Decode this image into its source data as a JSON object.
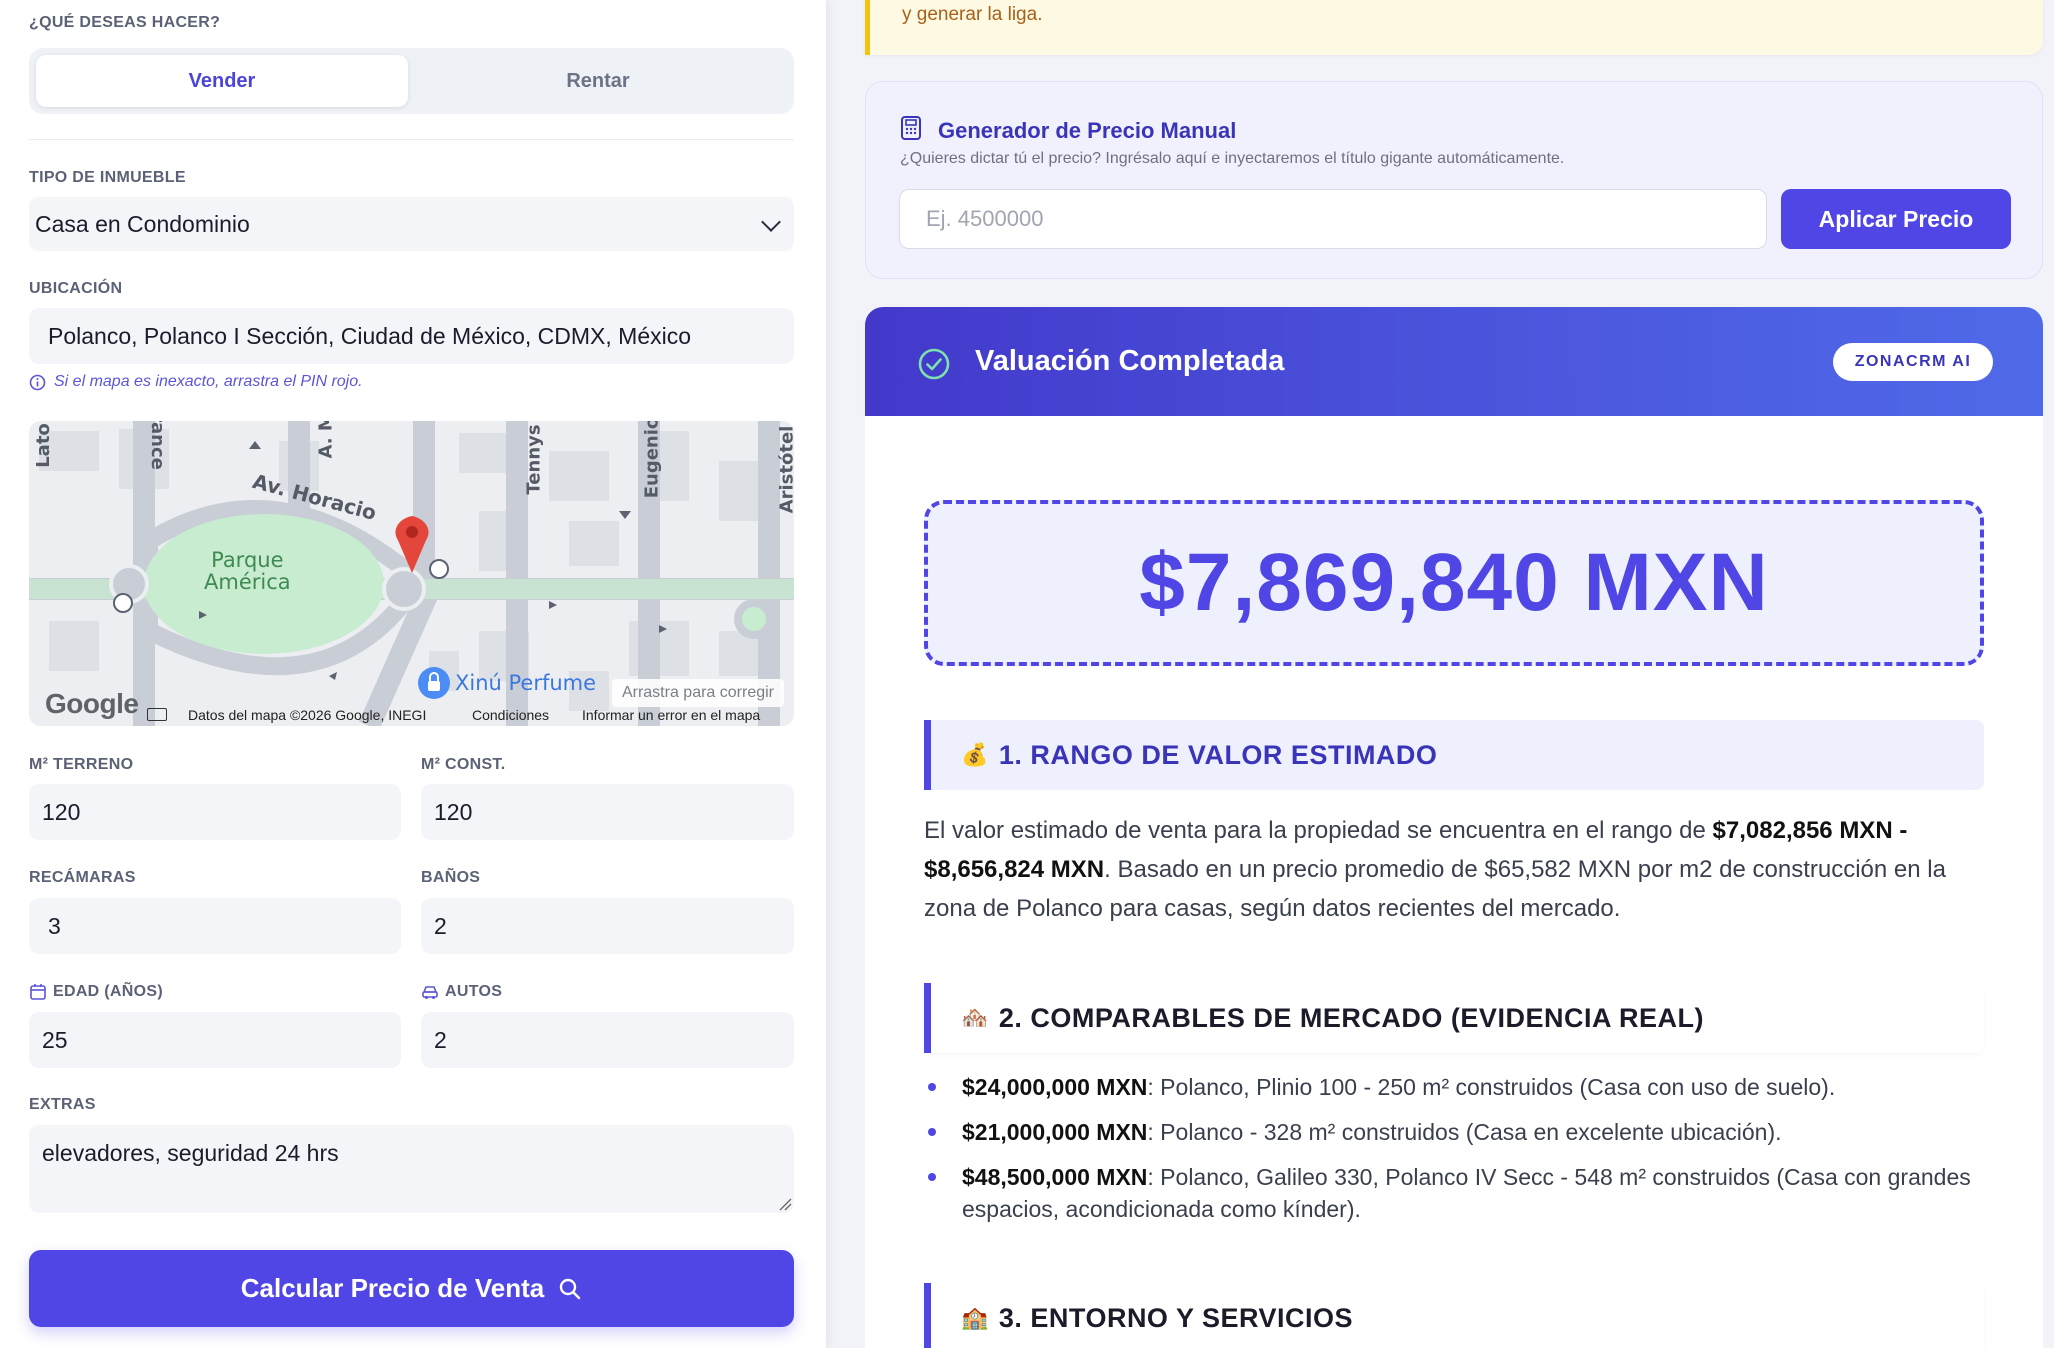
{
  "form": {
    "action_label": "¿QUÉ DESEAS HACER?",
    "operation_options": [
      "Vender",
      "Rentar"
    ],
    "operation_selected": "Vender",
    "property_type_label": "TIPO DE INMUEBLE",
    "property_type_value": "Casa en Condominio",
    "location_label": "UBICACIÓN",
    "location_value": "Polanco, Polanco I Sección, Ciudad de México, CDMX, México",
    "location_hint": "Si el mapa es inexacto, arrastra el PIN rojo.",
    "terreno_label": "M² TERRENO",
    "terreno_value": "120",
    "const_label": "M² CONST.",
    "const_value": "120",
    "recamaras_label": "RECÁMARAS",
    "recamaras_value": "3",
    "banos_label": "BAÑOS",
    "banos_value": "2",
    "edad_label": "EDAD (AÑOS)",
    "edad_value": "25",
    "autos_label": "AUTOS",
    "autos_value": "2",
    "extras_label": "EXTRAS",
    "extras_value": "elevadores, seguridad 24 hrs",
    "submit_label": "Calcular Precio de Venta"
  },
  "map": {
    "streets": [
      "Av. Horacio",
      "A. Mu",
      "Tennys",
      "Eugenio",
      "Aristótel",
      "rance",
      "Lato"
    ],
    "park_name": "Parque\nAmérica",
    "poi": "Xinú Perfume",
    "drag_hint": "Arrastra para corregir",
    "logo": "Google",
    "attribution": "Datos del mapa ©2026 Google, INEGI",
    "terms": "Condiciones",
    "report": "Informar un error en el mapa"
  },
  "notice": {
    "text": "y generar la liga."
  },
  "manual_price": {
    "title": "Generador de Precio Manual",
    "subtitle": "¿Quieres dictar tú el precio? Ingrésalo aquí e inyectaremos el título gigante automáticamente.",
    "placeholder": "Ej. 4500000",
    "button": "Aplicar Precio"
  },
  "valuation": {
    "title": "Valuación Completada",
    "badge": "ZONACRM AI",
    "price": "$7,869,840 MXN",
    "section1_icon": "💰",
    "section1_title": "1. RANGO DE VALOR ESTIMADO",
    "section1_text_a": "El valor estimado de venta para la propiedad se encuentra en el rango de ",
    "section1_range": "$7,082,856 MXN - $8,656,824 MXN",
    "section1_text_b": ". Basado en un precio promedio de $65,582 MXN por m2 de construcción en la zona de Polanco para casas, según datos recientes del mercado.",
    "section2_icon": "🏘️",
    "section2_title": "2. COMPARABLES DE MERCADO (EVIDENCIA REAL)",
    "comparables": [
      {
        "price": "$24,000,000 MXN",
        "text": ": Polanco, Plinio 100 - 250 m² construidos (Casa con uso de suelo)."
      },
      {
        "price": "$21,000,000 MXN",
        "text": ": Polanco - 328 m² construidos (Casa en excelente ubicación)."
      },
      {
        "price": "$48,500,000 MXN",
        "text": ": Polanco, Galileo 330, Polanco IV Secc - 548 m² construidos (Casa con grandes espacios, acondicionada como kínder)."
      }
    ],
    "section3_icon": "🏫",
    "section3_title": "3. ENTORNO Y SERVICIOS"
  },
  "colors": {
    "accent": "#4f46e5",
    "notice_border": "#f1c40f",
    "park": "#c8ecd0"
  }
}
